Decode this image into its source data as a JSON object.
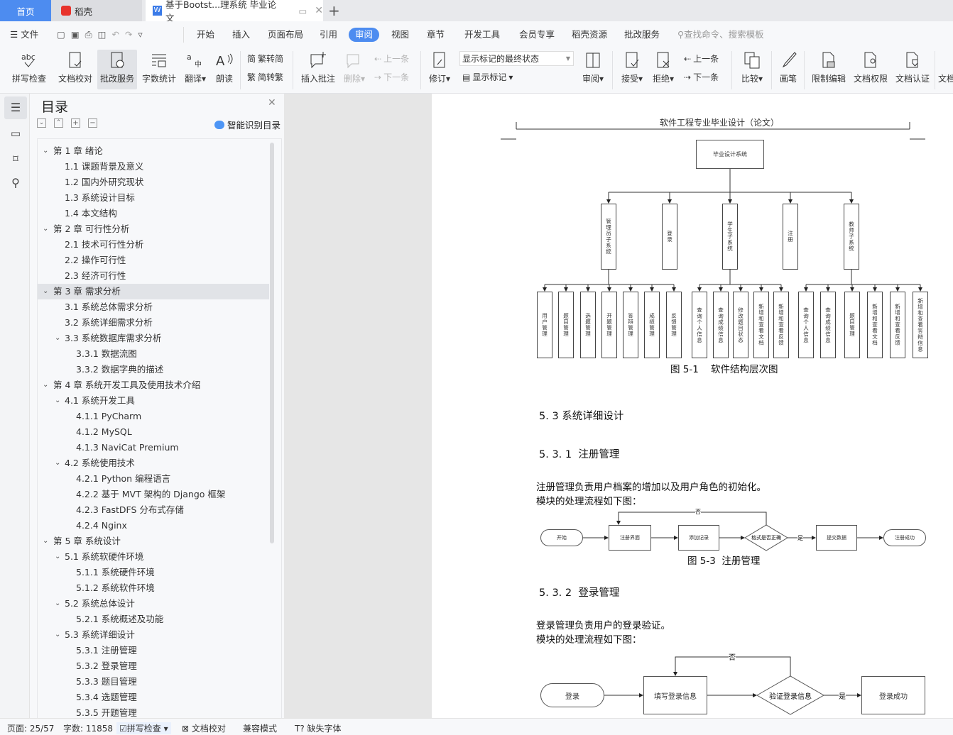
{
  "tabs": [
    {
      "label": "首页",
      "active_color": "#4d8cf0"
    },
    {
      "label": "稻壳"
    },
    {
      "label": "基于Bootst...理系统 毕业论文"
    }
  ],
  "new_tab": "+",
  "menu": {
    "file": "文件",
    "items": [
      "开始",
      "插入",
      "页面布局",
      "引用",
      "审阅",
      "视图",
      "章节",
      "开发工具",
      "会员专享",
      "稻壳资源",
      "批改服务"
    ],
    "active": "审阅",
    "search_placeholder": "查找命令、搜索模板"
  },
  "toolbar": {
    "spell_check": "拼写检查",
    "doc_proofread": "文档校对",
    "correction_service": "批改服务",
    "word_count": "字数统计",
    "translate": "翻译",
    "read_aloud": "朗读",
    "trad_to_simp": "繁转简",
    "simp_to_trad": "简转繁",
    "insert_comment": "插入批注",
    "delete": "删除",
    "prev": "上一条",
    "next": "下一条",
    "revise": "修订",
    "markup_select": "显示标记的最终状态",
    "show_markup": "显示标记",
    "review": "审阅",
    "accept": "接受",
    "reject": "拒绝",
    "prev2": "上一条",
    "next2": "下一条",
    "compare": "比较",
    "pen": "画笔",
    "restrict_edit": "限制编辑",
    "doc_permission": "文档权限",
    "doc_cert": "文档认证",
    "doc_more": "文档"
  },
  "toc": {
    "title": "目录",
    "smart": "智能识别目录",
    "items": [
      {
        "t": "第 1 章  绪论",
        "l": 0,
        "e": true
      },
      {
        "t": "1.1  课题背景及意义",
        "l": 1
      },
      {
        "t": "1.2  国内外研究现状",
        "l": 1
      },
      {
        "t": "1.3 系统设计目标",
        "l": 1
      },
      {
        "t": "1.4  本文结构",
        "l": 1
      },
      {
        "t": "第 2 章  可行性分析",
        "l": 0,
        "e": true
      },
      {
        "t": "2.1  技术可行性分析",
        "l": 1
      },
      {
        "t": "2.2  操作可行性",
        "l": 1
      },
      {
        "t": "2.3  经济可行性",
        "l": 1
      },
      {
        "t": "第 3 章  需求分析",
        "l": 0,
        "e": true,
        "sel": true
      },
      {
        "t": "3.1 系统总体需求分析",
        "l": 1
      },
      {
        "t": "3.2 系统详细需求分析",
        "l": 1
      },
      {
        "t": "3.3  系统数据库需求分析",
        "l": 1,
        "e": true
      },
      {
        "t": "3.3.1  数据流图",
        "l": 2
      },
      {
        "t": "3.3.2 数据字典的描述",
        "l": 2
      },
      {
        "t": "第 4 章  系统开发工具及使用技术介绍",
        "l": 0,
        "e": true
      },
      {
        "t": "4.1  系统开发工具",
        "l": 1,
        "e": true
      },
      {
        "t": "4.1.1 PyCharm",
        "l": 2
      },
      {
        "t": "4.1.2 MySQL",
        "l": 2
      },
      {
        "t": "4.1.3 NaviCat Premium",
        "l": 2
      },
      {
        "t": "4.2  系统使用技术",
        "l": 1,
        "e": true
      },
      {
        "t": "4.2.1 Python 编程语言",
        "l": 2
      },
      {
        "t": "4.2.2 基于 MVT 架构的 Django 框架",
        "l": 2
      },
      {
        "t": "4.2.3 FastDFS 分布式存储",
        "l": 2
      },
      {
        "t": "4.2.4 Nginx",
        "l": 2
      },
      {
        "t": "第 5 章  系统设计",
        "l": 0,
        "e": true
      },
      {
        "t": "5.1 系统软硬件环境",
        "l": 1,
        "e": true
      },
      {
        "t": "5.1.1  系统硬件环境",
        "l": 2
      },
      {
        "t": "5.1.2  系统软件环境",
        "l": 2
      },
      {
        "t": "5.2 系统总体设计",
        "l": 1,
        "e": true
      },
      {
        "t": "5.2.1 系统概述及功能",
        "l": 2
      },
      {
        "t": "5.3 系统详细设计",
        "l": 1,
        "e": true
      },
      {
        "t": "5.3.1  注册管理",
        "l": 2
      },
      {
        "t": "5.3.2  登录管理",
        "l": 2
      },
      {
        "t": "5.3.3  题目管理",
        "l": 2
      },
      {
        "t": "5.3.4  选题管理",
        "l": 2
      },
      {
        "t": "5.3.5  开题管理",
        "l": 2
      }
    ]
  },
  "document": {
    "header": "软件工程专业毕业设计（论文）",
    "hierarchy": {
      "root": "毕业设计系统",
      "groups": [
        {
          "name": "管理员子系统",
          "children": [
            "用户管理",
            "题目管理",
            "选题管理",
            "开题管理",
            "答辩管理",
            "成绩管理",
            "反馈管理"
          ]
        },
        {
          "name": "登录",
          "children": []
        },
        {
          "name": "学生子系统",
          "children": [
            "查询个人信息",
            "查询成绩信息",
            "修改题目状态",
            "新增和查看文档",
            "新增和查看反馈"
          ]
        },
        {
          "name": "注册",
          "children": []
        },
        {
          "name": "教师子系统",
          "children": [
            "查询个人信息",
            "查询成绩信息",
            "题目管理",
            "新增和查看文档",
            "新增和查看反馈",
            "新增和查看答辩信息"
          ]
        }
      ],
      "caption": "图 5-1    软件结构层次图"
    },
    "h_533": "5. 3 系统详细设计",
    "h_5331": "5. 3. 1  注册管理",
    "p_reg": [
      "注册管理负责用户档案的增加以及用户角色的初始化。",
      "模块的处理流程如下图："
    ],
    "flow_reg": {
      "start": "开始",
      "n1": "注册界面",
      "n2": "添加记录",
      "decision": "格式是否正确",
      "n3": "提交数据",
      "end": "注册成功",
      "no": "否",
      "yes": "是",
      "caption": "图 5-3  注册管理"
    },
    "h_5332": "5. 3. 2  登录管理",
    "p_login": [
      "登录管理负责用户的登录验证。",
      "模块的处理流程如下图："
    ],
    "flow_login": {
      "start": "登录",
      "n1": "填写登录信息",
      "decision": "验证登录信息",
      "end": "登录成功",
      "no": "否",
      "yes": "是"
    }
  },
  "status": {
    "page": "页面: 25/57",
    "words": "字数: 11858",
    "spell": "拼写检查",
    "proof": "文档校对",
    "compat": "兼容模式",
    "missing_font": "缺失字体"
  }
}
